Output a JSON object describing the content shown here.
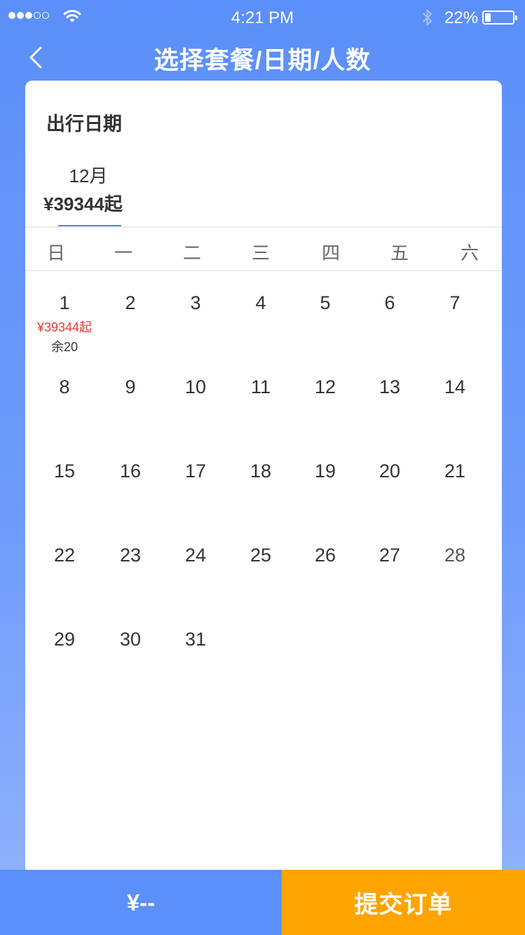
{
  "status_bar": {
    "time": "4:21 PM",
    "battery_percent": "22%",
    "battery_level": 0.22,
    "signal_bars_filled": 3,
    "signal_bars_total": 5,
    "icons": [
      "signal-dots-icon",
      "wifi-icon",
      "bluetooth-icon",
      "battery-icon"
    ]
  },
  "nav": {
    "title": "选择套餐/日期/人数",
    "back_icon": "chevron-left-icon"
  },
  "calendar": {
    "section_title": "出行日期",
    "month_tab": {
      "label": "12月",
      "price": "¥39344起"
    },
    "weekdays": [
      "日",
      "一",
      "二",
      "三",
      "四",
      "五",
      "六"
    ],
    "days": [
      {
        "day": "1",
        "price": "¥39344起",
        "stock": "余20"
      },
      {
        "day": "2"
      },
      {
        "day": "3"
      },
      {
        "day": "4"
      },
      {
        "day": "5"
      },
      {
        "day": "6"
      },
      {
        "day": "7"
      },
      {
        "day": "8"
      },
      {
        "day": "9"
      },
      {
        "day": "10"
      },
      {
        "day": "11"
      },
      {
        "day": "12"
      },
      {
        "day": "13"
      },
      {
        "day": "14"
      },
      {
        "day": "15"
      },
      {
        "day": "16"
      },
      {
        "day": "17"
      },
      {
        "day": "18"
      },
      {
        "day": "19"
      },
      {
        "day": "20"
      },
      {
        "day": "21"
      },
      {
        "day": "22"
      },
      {
        "day": "23"
      },
      {
        "day": "24"
      },
      {
        "day": "25"
      },
      {
        "day": "26"
      },
      {
        "day": "27"
      },
      {
        "day": "28",
        "dim": true
      },
      {
        "day": "29"
      },
      {
        "day": "30"
      },
      {
        "day": "31"
      }
    ]
  },
  "bottom_bar": {
    "price": "¥--",
    "submit_label": "提交订单"
  },
  "colors": {
    "primary_blue": "#5b8ff9",
    "indicator_blue": "#5b7ff0",
    "submit_orange": "#ffa400",
    "price_red": "#e53935"
  }
}
